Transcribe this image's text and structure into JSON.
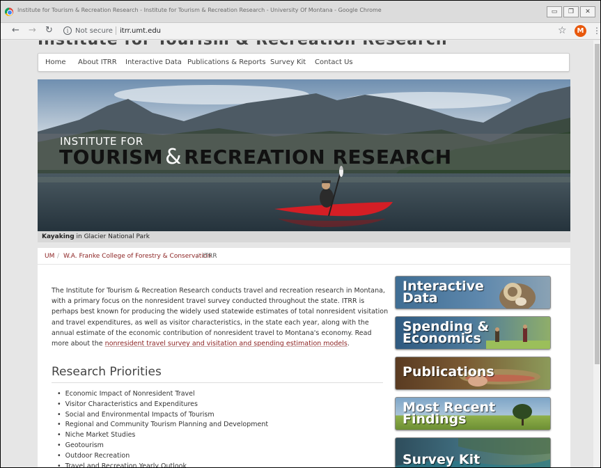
{
  "browser": {
    "window_title": "Institute for Tourism & Recreation Research - Institute for Tourism & Recreation Research - University Of Montana - Google Chrome",
    "security_label": "Not secure",
    "url": "itrr.umt.edu",
    "avatar_letter": "M"
  },
  "site": {
    "title": "Institute for Tourism & Recreation Research"
  },
  "nav": {
    "items": [
      "Home",
      "About ITRR",
      "Interactive Data",
      "Publications & Reports",
      "Survey Kit",
      "Contact Us"
    ]
  },
  "hero": {
    "line1": "INSTITUTE FOR",
    "line2_a": "TOURISM",
    "line2_amp": "&",
    "line2_b": "RECREATION RESEARCH",
    "caption_bold": "Kayaking",
    "caption_rest": " in Glacier National Park"
  },
  "breadcrumb": {
    "items": [
      "UM",
      "W.A. Franke College of Forestry & Conservation",
      "ITRR"
    ],
    "separator": "/"
  },
  "intro": {
    "text": "The Institute for Tourism & Recreation Research conducts travel and recreation research in Montana, with a primary focus on the nonresident travel survey conducted throughout the state. ITRR is perhaps best known for producing the widely used statewide estimates of total nonresident visitation and travel expenditures, as well as visitor characteristics, in the state each year, along with the annual estimate of the economic contribution of nonresident travel to Montana's economy. Read more about the ",
    "link": "nonresident travel survey and visitation and spending estimation models",
    "end": "."
  },
  "research": {
    "title": "Research Priorities",
    "items": [
      "Economic Impact of Nonresident Travel",
      "Visitor Characteristics and Expenditures",
      "Social and Environmental Impacts of Tourism",
      "Regional and Community Tourism Planning and Development",
      "Niche Market Studies",
      "Geotourism",
      "Outdoor Recreation",
      "Travel and Recreation Yearly Outlook"
    ]
  },
  "tiles": [
    {
      "line1": "Interactive",
      "line2": "Data"
    },
    {
      "line1": "Spending &",
      "line2": "Economics"
    },
    {
      "line1": "Publications",
      "line2": ""
    },
    {
      "line1": "Most Recent",
      "line2": "Findings"
    },
    {
      "line1": "Survey Kit",
      "line2": ""
    }
  ],
  "colors": {
    "link": "#8a1f1f",
    "kayak": "#d41e25",
    "avatar": "#e8580c"
  }
}
